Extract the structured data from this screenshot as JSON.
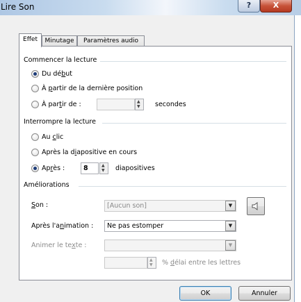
{
  "window": {
    "title": "Lire Son",
    "help_glyph": "?",
    "close_glyph": "X"
  },
  "tabs": [
    {
      "label": "Effet"
    },
    {
      "label": "Minutage"
    },
    {
      "label": "Paramètres audio"
    }
  ],
  "start": {
    "header": "Commencer la lecture",
    "options": {
      "from_start": {
        "pre": "Du dé",
        "accel": "b",
        "post": "ut"
      },
      "from_last": {
        "pre": "À ",
        "accel": "p",
        "post": "artir de la dernière position"
      },
      "from_time": {
        "pre": "À par",
        "accel": "t",
        "post": "ir de :"
      }
    },
    "time_value": "",
    "seconds_label": "secondes"
  },
  "stop": {
    "header": "Interrompre la lecture",
    "options": {
      "on_click": {
        "pre": "Au ",
        "accel": "c",
        "post": "lic"
      },
      "after_slide": {
        "pre": "Après la d",
        "accel": "i",
        "post": "apositive en cours"
      },
      "after_n": {
        "pre": "Ap",
        "accel": "r",
        "post": "ès :"
      }
    },
    "after_n_value": "8",
    "slides_label": "diapositives"
  },
  "enhancements": {
    "header": "Améliorations",
    "sound": {
      "pre": "",
      "accel": "S",
      "post": "on :",
      "value": "[Aucun son]"
    },
    "after_animation": {
      "pre": "Après l'a",
      "accel": "n",
      "post": "imation :",
      "value": "Ne pas estomper"
    },
    "animate_text": {
      "pre": "Animer le te",
      "accel": "x",
      "post": "te :",
      "value": ""
    },
    "delay": {
      "value": "",
      "pre": "% ",
      "accel": "d",
      "post": "élai entre les lettres"
    },
    "speaker_icon": "speaker-icon"
  },
  "buttons": {
    "ok": "OK",
    "cancel": "Annuler"
  },
  "selection": {
    "active_tab": "Effet",
    "start_option": "from_start",
    "stop_option": "after_n"
  }
}
